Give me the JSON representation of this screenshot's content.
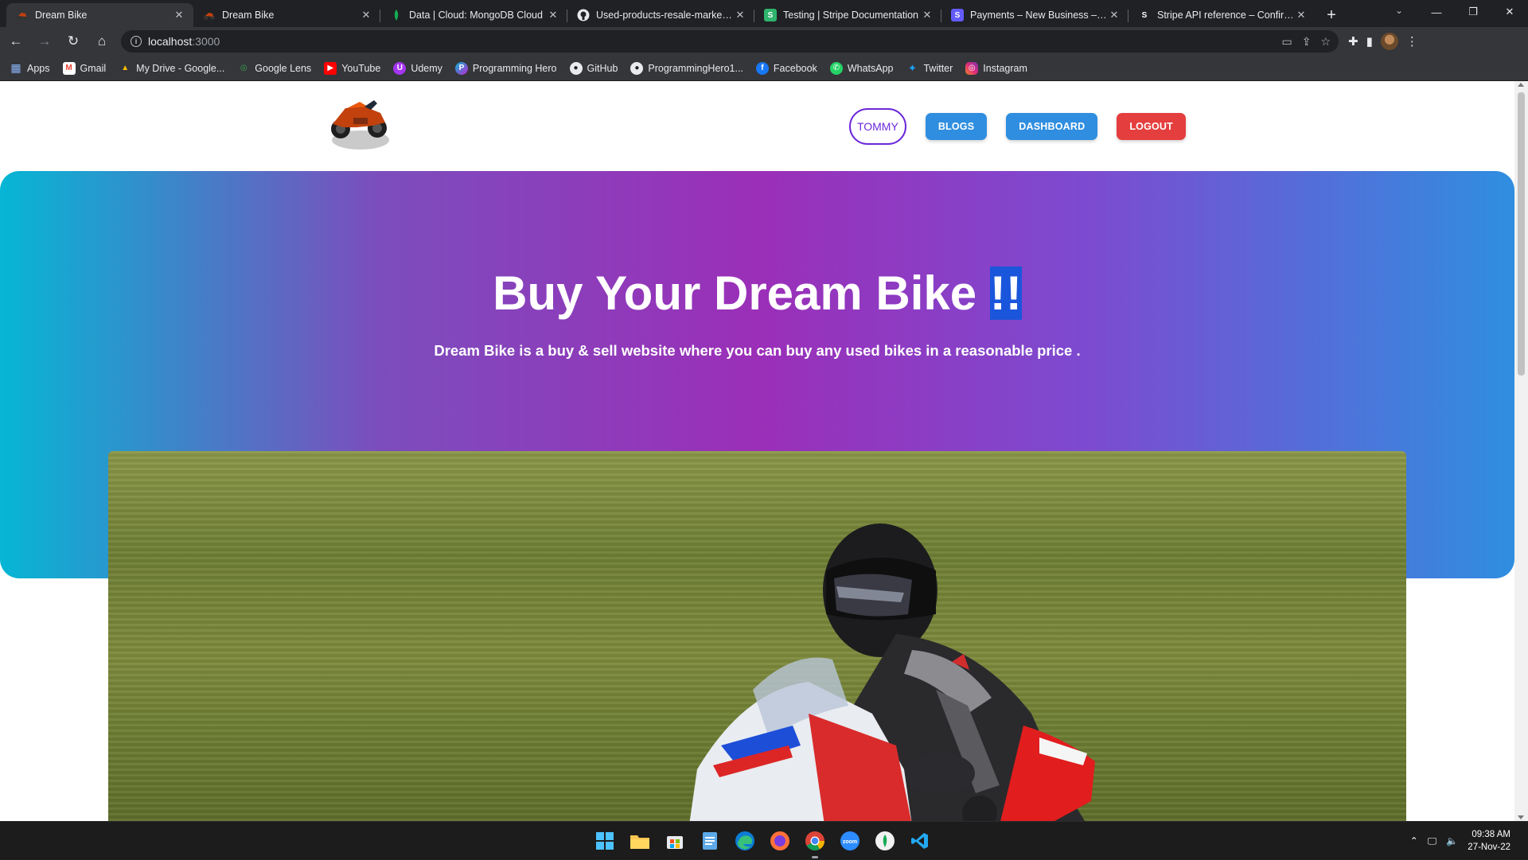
{
  "browser": {
    "tabs": [
      {
        "title": "Dream Bike",
        "favicon": "dream-bike-icon",
        "active": true
      },
      {
        "title": "Dream Bike",
        "favicon": "dream-bike-icon",
        "active": false
      },
      {
        "title": "Data | Cloud: MongoDB Cloud",
        "favicon": "mongodb-icon",
        "active": false
      },
      {
        "title": "Used-products-resale-market-A",
        "favicon": "github-icon",
        "active": false
      },
      {
        "title": "Testing | Stripe Documentation",
        "favicon": "stripe-icon",
        "active": false
      },
      {
        "title": "Payments – New Business – Strip",
        "favicon": "stripe-icon",
        "active": false
      },
      {
        "title": "Stripe API reference – Confirm a",
        "favicon": "stripe-icon",
        "active": false
      }
    ],
    "address": {
      "host": "localhost",
      "port": ":3000"
    },
    "bookmarks": [
      {
        "label": "Apps",
        "icon": "apps-grid-icon",
        "color": "#4285f4"
      },
      {
        "label": "Gmail",
        "icon": "gmail-icon",
        "color": "#ea4335"
      },
      {
        "label": "My Drive - Google...",
        "icon": "google-drive-icon",
        "color": "#fbbc04"
      },
      {
        "label": "Google Lens",
        "icon": "google-lens-icon",
        "color": "#34a853"
      },
      {
        "label": "YouTube",
        "icon": "youtube-icon",
        "color": "#ff0000"
      },
      {
        "label": "Udemy",
        "icon": "udemy-icon",
        "color": "#a435f0"
      },
      {
        "label": "Programming Hero",
        "icon": "programming-hero-icon",
        "color": "#c026d3"
      },
      {
        "label": "GitHub",
        "icon": "github-icon",
        "color": "#24292f"
      },
      {
        "label": "ProgrammingHero1...",
        "icon": "github-icon",
        "color": "#24292f"
      },
      {
        "label": "Facebook",
        "icon": "facebook-icon",
        "color": "#1877f2"
      },
      {
        "label": "WhatsApp",
        "icon": "whatsapp-icon",
        "color": "#25d366"
      },
      {
        "label": "Twitter",
        "icon": "twitter-icon",
        "color": "#1da1f2"
      },
      {
        "label": "Instagram",
        "icon": "instagram-icon",
        "color": "#e1306c"
      }
    ]
  },
  "site": {
    "nav": {
      "user": "TOMMY",
      "blogs": "BLOGS",
      "dashboard": "DASHBOARD",
      "logout": "LOGOUT"
    },
    "hero": {
      "title": "Buy Your Dream Bike ",
      "title_highlight": "!!",
      "subtitle": "Dream Bike is a buy & sell website where you can buy any used bikes in a reasonable price ."
    },
    "colors": {
      "gradient": [
        "#06b6d4",
        "#9b2fb8",
        "#2f8ee0"
      ],
      "logout": "#e53e3e",
      "primary": "#2f8ee0",
      "user_outline": "#6d28d9"
    }
  },
  "taskbar": {
    "apps": [
      "windows-start-icon",
      "file-explorer-icon",
      "microsoft-store-icon",
      "notepad-icon",
      "edge-icon",
      "firefox-icon",
      "chrome-icon",
      "zoom-icon",
      "mongodb-compass-icon",
      "vscode-icon"
    ],
    "time": "09:38 AM",
    "date": "27-Nov-22"
  }
}
